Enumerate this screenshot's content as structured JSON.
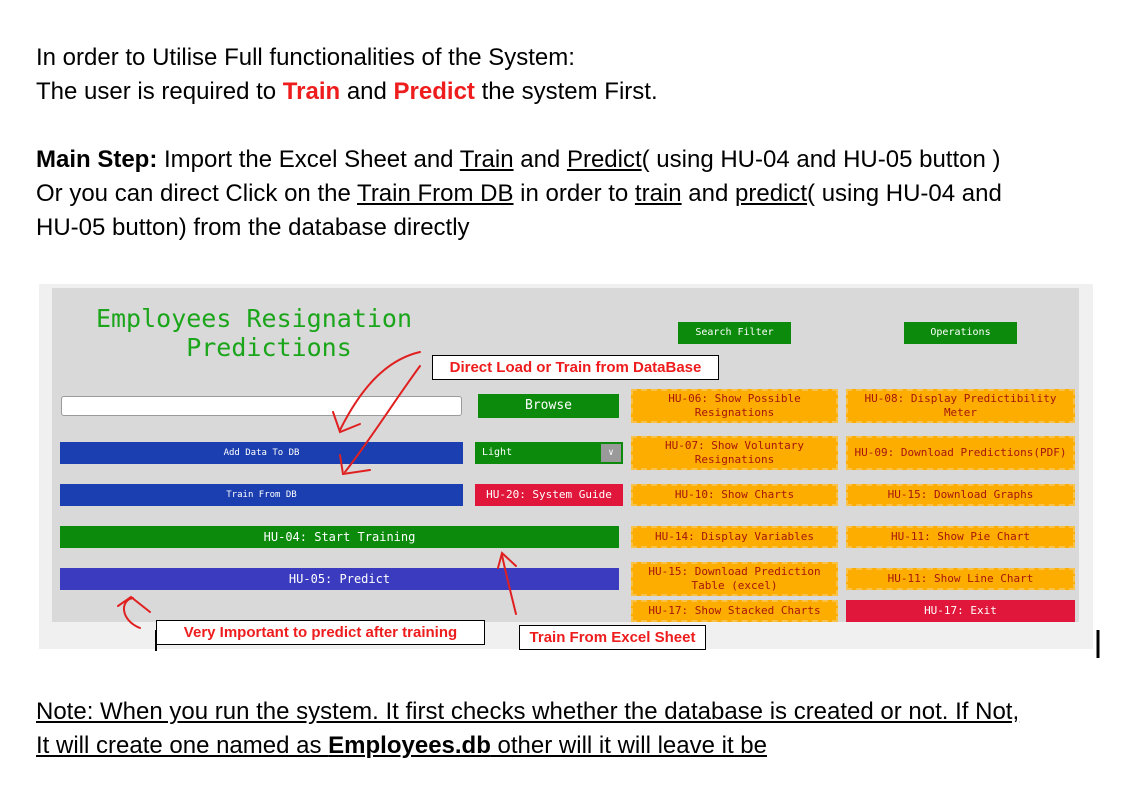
{
  "intro": {
    "line1": "In order to Utilise Full functionalities of the System:",
    "line2_prefix": "The user is required to ",
    "train": "Train",
    "and1": " and ",
    "predict": "Predict",
    "line2_suffix": " the system First."
  },
  "main_step": {
    "label": "Main Step:",
    "l1_text1": " Import the Excel Sheet and ",
    "l1_train": "Train",
    "l1_and": " and ",
    "l1_predict": "Predict",
    "l1_tail": "( using HU-04 and HU-05 button )",
    "l2_text1": "Or you can direct Click on the ",
    "l2_trainfromdb": "Train From DB",
    "l2_text2": " in order to ",
    "l2_train": "train",
    "l2_and": " and ",
    "l2_predict": "predict",
    "l2_tail": "( using HU-04 and",
    "l3": "HU-05 button)  from the database directly"
  },
  "app": {
    "title_line1": "Employees Resignation",
    "title_line2": "Predictions",
    "search_filter": "Search Filter",
    "operations": "Operations",
    "browse": "Browse",
    "add_data_to_db": "Add Data To DB",
    "train_from_db": "Train From DB",
    "theme_select_value": "Light",
    "system_guide": "HU-20: System Guide",
    "start_training": "HU-04: Start Training",
    "predict": "HU-05: Predict",
    "hu06": "HU-06: Show Possible Resignations",
    "hu07": "HU-07: Show Voluntary Resignations",
    "hu10": "HU-10: Show Charts",
    "hu14": "HU-14: Display Variables",
    "hu15a": "HU-15: Download Prediction Table (excel)",
    "hu17a": "HU-17: Show Stacked Charts",
    "hu08": "HU-08: Display Predictibility Meter",
    "hu09": "HU-09: Download Predictions(PDF)",
    "hu15b": "HU-15: Download Graphs",
    "hu11a": "HU-11: Show Pie Chart",
    "hu11b": "HU-11: Show Line Chart",
    "hu17b": "HU-17: Exit"
  },
  "callouts": {
    "direct_load": "Direct Load or Train from DataBase",
    "important": "Very Important to predict after training",
    "train_excel": "Train From Excel Sheet"
  },
  "note": {
    "line1": "Note: When you run the system. It first checks whether the database is created or not. If Not,",
    "line2_prefix": "It will create one named as ",
    "dbname": "Employees.db",
    "line2_suffix": " other will it will leave it be"
  },
  "colors": {
    "accent_red": "#ee1c1c",
    "app_green": "#0b8a0b",
    "app_blue": "#1b3fb0",
    "app_orange": "#fcad00"
  }
}
